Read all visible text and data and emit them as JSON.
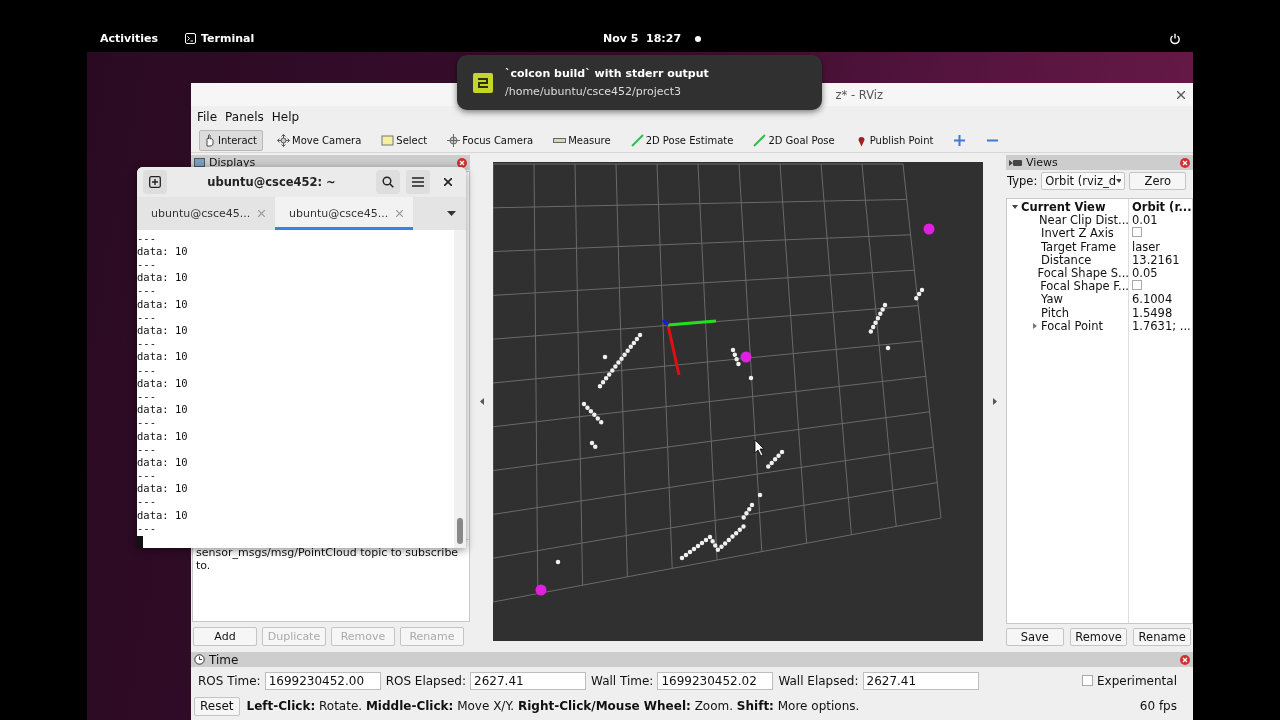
{
  "top_bar": {
    "activities": "Activities",
    "app": "Terminal",
    "clock": "Nov 5  18:27"
  },
  "notification": {
    "title": "`colcon build` with stderr output",
    "body": "/home/ubuntu/csce452/project3"
  },
  "rviz": {
    "title": "z* - RViz",
    "menu": [
      "File",
      "Panels",
      "Help"
    ],
    "tools": [
      {
        "kind": "hand",
        "label": "Interact",
        "selected": true
      },
      {
        "kind": "move",
        "label": "Move Camera",
        "selected": false
      },
      {
        "kind": "select",
        "label": "Select",
        "selected": false
      },
      {
        "kind": "focus",
        "label": "Focus Camera",
        "selected": false
      },
      {
        "kind": "measure",
        "label": "Measure",
        "selected": false
      },
      {
        "kind": "pose",
        "label": "2D Pose Estimate",
        "selected": false
      },
      {
        "kind": "goal",
        "label": "2D Goal Pose",
        "selected": false
      },
      {
        "kind": "pin",
        "label": "Publish Point",
        "selected": false
      },
      {
        "kind": "plus",
        "selected": false
      },
      {
        "kind": "minus",
        "selected": false
      }
    ],
    "displays": {
      "title": "Displays",
      "description": "sensor_msgs/msg/PointCloud topic to subscribe to.",
      "buttons": [
        {
          "label": "Add",
          "disabled": false
        },
        {
          "label": "Duplicate",
          "disabled": true
        },
        {
          "label": "Remove",
          "disabled": true
        },
        {
          "label": "Rename",
          "disabled": true
        }
      ]
    },
    "views": {
      "title": "Views",
      "type_label": "Type:",
      "type_value": "Orbit (rviz_d",
      "zero": "Zero",
      "tree": [
        {
          "name": "Current View",
          "value": "Orbit (r...",
          "kind": "text",
          "expanded": true,
          "children": [
            {
              "name": "Near Clip Dist...",
              "value": "0.01",
              "kind": "text"
            },
            {
              "name": "Invert Z Axis",
              "kind": "checkbox",
              "checked": false
            },
            {
              "name": "Target Frame",
              "value": "laser",
              "kind": "text"
            },
            {
              "name": "Distance",
              "value": "13.2161",
              "kind": "text"
            },
            {
              "name": "Focal Shape S...",
              "value": "0.05",
              "kind": "text"
            },
            {
              "name": "Focal Shape F...",
              "kind": "checkbox",
              "checked": false
            },
            {
              "name": "Yaw",
              "value": "6.1004",
              "kind": "text"
            },
            {
              "name": "Pitch",
              "value": "1.5498",
              "kind": "text"
            },
            {
              "name": "Focal Point",
              "value": "1.7631; ...",
              "kind": "text",
              "expanded": false
            }
          ]
        }
      ],
      "buttons": [
        "Save",
        "Remove",
        "Rename"
      ]
    },
    "time": {
      "title": "Time",
      "fields": [
        {
          "label": "ROS Time:",
          "value": "1699230452.00"
        },
        {
          "label": "ROS Elapsed:",
          "value": "2627.41"
        },
        {
          "label": "Wall Time:",
          "value": "1699230452.02"
        },
        {
          "label": "Wall Elapsed:",
          "value": "2627.41"
        }
      ],
      "experimental": {
        "label": "Experimental",
        "checked": false
      }
    },
    "status": {
      "reset": "Reset",
      "hint": "**Left-Click:** Rotate. **Middle-Click:** Move X/Y. **Right-Click/Mouse Wheel:** Zoom. **Shift:** More options.",
      "fps": "60 fps"
    }
  },
  "terminal": {
    "title": "ubuntu@csce452: ~",
    "tabs": [
      {
        "label": "ubuntu@csce45...",
        "selected": false
      },
      {
        "label": "ubuntu@csce45...",
        "selected": true
      }
    ],
    "lines": [
      "---",
      "data: 10",
      "---",
      "data: 10",
      "---",
      "data: 10",
      "---",
      "data: 10",
      "---",
      "data: 10",
      "---",
      "data: 10",
      "---",
      "data: 10",
      "---",
      "data: 10",
      "---",
      "data: 10",
      "---",
      "data: 10",
      "---",
      "data: 10",
      "---"
    ]
  }
}
